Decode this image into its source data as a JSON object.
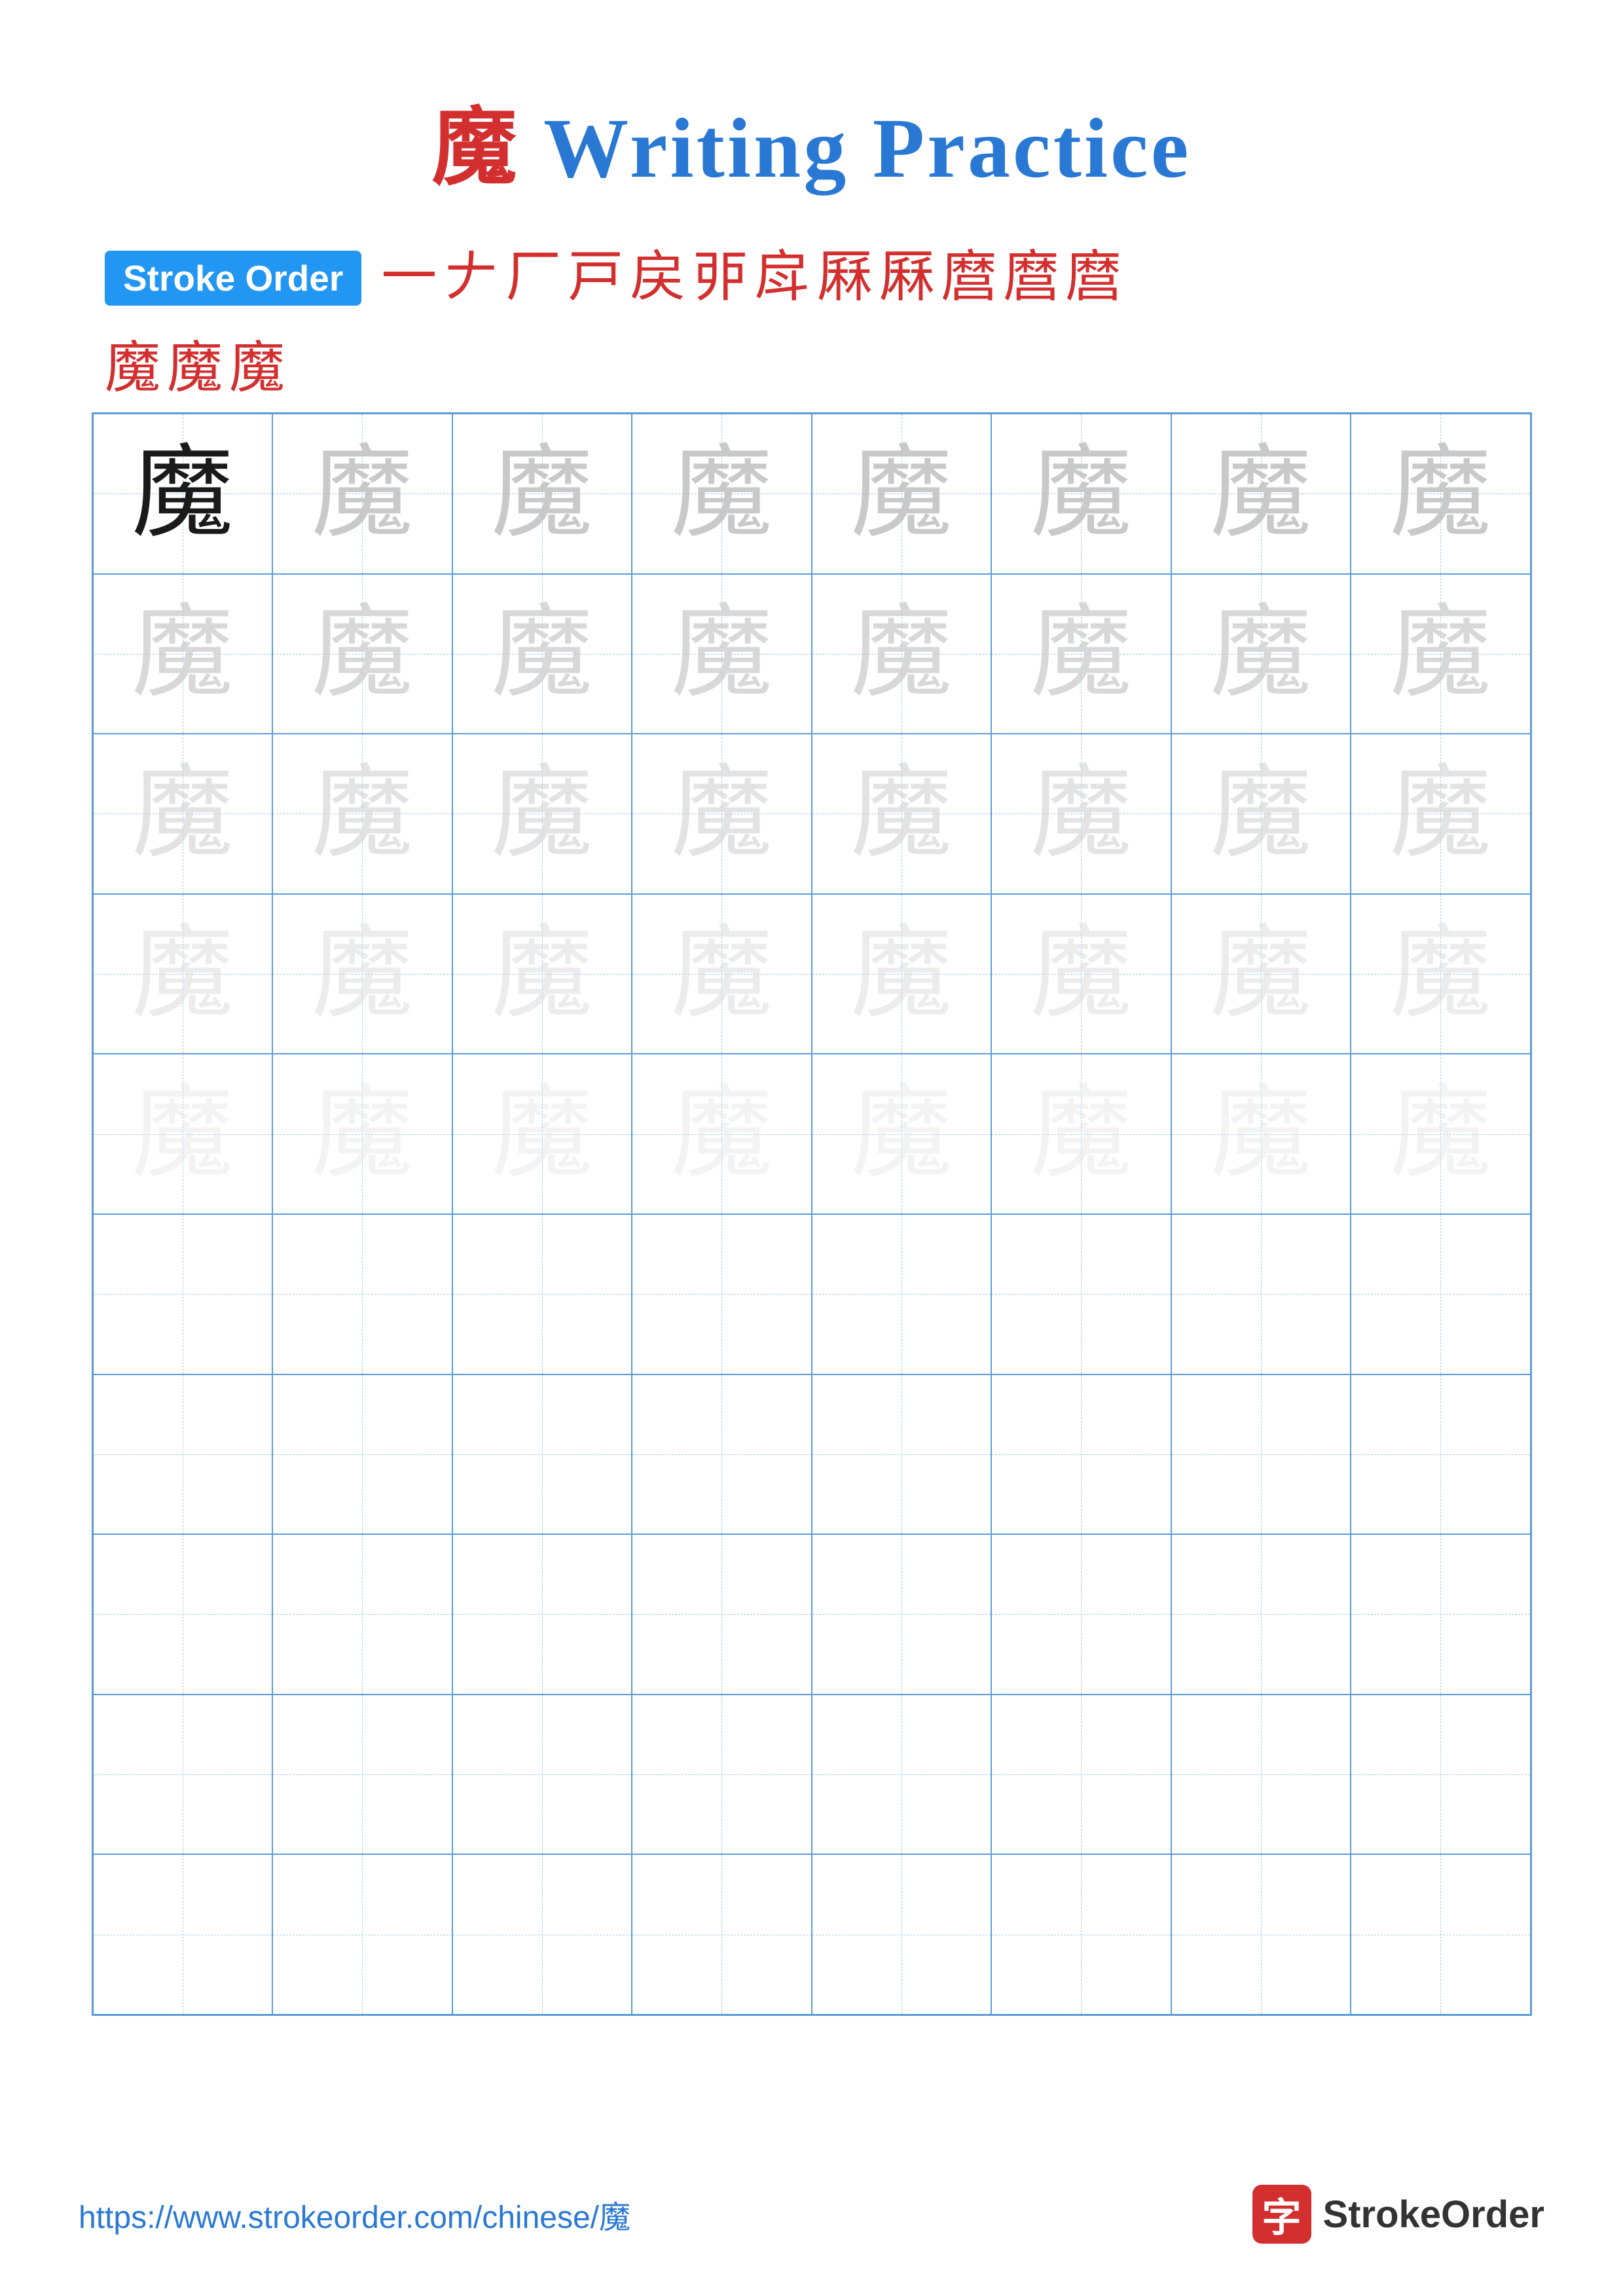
{
  "page": {
    "title": {
      "char": "魔",
      "text": " Writing Practice"
    },
    "stroke_order": {
      "badge_label": "Stroke Order",
      "strokes_row1": [
        "一",
        "𠂇",
        "厂",
        "戸",
        "戹",
        "戻",
        "戼",
        "戽",
        "厤",
        "麿",
        "麿",
        "麿"
      ],
      "strokes_row2": [
        "麿",
        "魔",
        "魔"
      ]
    },
    "character": "魔",
    "grid": {
      "rows": 10,
      "cols": 8
    },
    "footer": {
      "url": "https://www.strokeorder.com/chinese/魔",
      "logo_char": "字",
      "logo_text": "StrokeOrder"
    }
  }
}
